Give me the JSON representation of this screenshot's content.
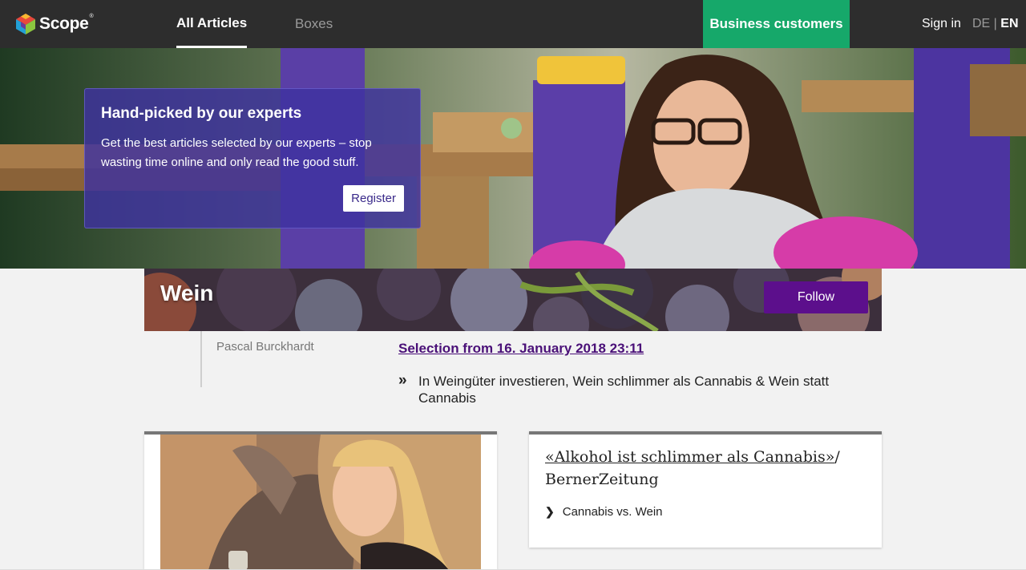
{
  "header": {
    "logo_text": "Scope",
    "logo_reg": "®",
    "tabs": [
      {
        "label": "All Articles",
        "active": true
      },
      {
        "label": "Boxes",
        "active": false
      }
    ],
    "business_label": "Business customers",
    "signin_label": "Sign in",
    "lang_de": "DE",
    "lang_sep": " | ",
    "lang_en": "EN",
    "colors": {
      "bar": "#2d2d2d",
      "business": "#16a86a"
    }
  },
  "hero": {
    "promo_title": "Hand-picked by our experts",
    "promo_text": "Get the best articles selected by our experts – stop wasting time online and only read the good stuff.",
    "register_label": "Register",
    "colors": {
      "promo": "#3e32a0"
    }
  },
  "topic": {
    "title": "Wein",
    "follow_label": "Follow",
    "colors": {
      "follow": "#5c0f8c"
    }
  },
  "selection": {
    "author": "Pascal Burckhardt",
    "link_text": "Selection from 16. January 2018 23:11",
    "summary_marker": "»",
    "summary": "In Weingüter investieren, Wein schlimmer als Cannabis & Wein statt Cannabis"
  },
  "article_card": {
    "title_link": "«Alkohol ist schlimmer als Cannabis»",
    "title_source": "/ BernerZeitung",
    "link_marker": "❯",
    "link_label": "Cannabis vs. Wein"
  },
  "icons": {
    "logo": "scope-cube-logo",
    "selection": "double-chevron-icon",
    "link": "chevron-right-icon"
  }
}
